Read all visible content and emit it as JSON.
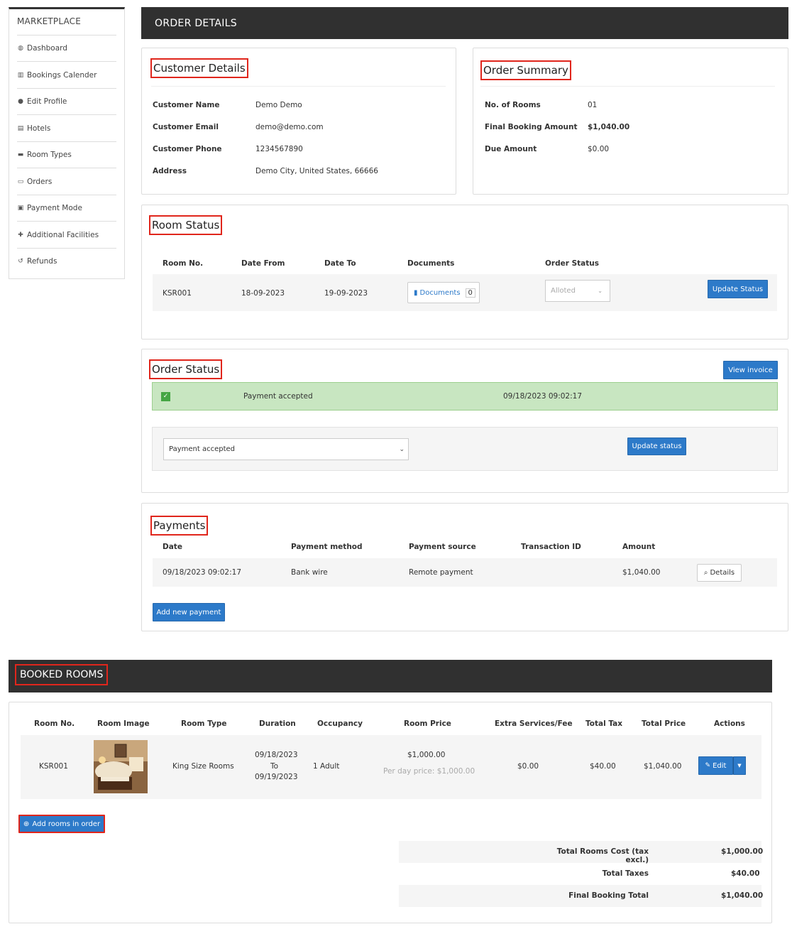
{
  "sidebar": {
    "title": "MARKETPLACE",
    "items": [
      {
        "label": "Dashboard",
        "icon": "dashboard-icon"
      },
      {
        "label": "Bookings Calender",
        "icon": "bar-chart-icon"
      },
      {
        "label": "Edit Profile",
        "icon": "user-icon"
      },
      {
        "label": "Hotels",
        "icon": "building-icon"
      },
      {
        "label": "Room Types",
        "icon": "bed-icon"
      },
      {
        "label": "Orders",
        "icon": "credit-card-icon"
      },
      {
        "label": "Payment Mode",
        "icon": "money-icon"
      },
      {
        "label": "Additional Facilities",
        "icon": "user-plus-icon"
      },
      {
        "label": "Refunds",
        "icon": "undo-icon"
      }
    ]
  },
  "header": {
    "title": "ORDER DETAILS"
  },
  "customer": {
    "title": "Customer Details",
    "name_label": "Customer Name",
    "name": "Demo  Demo",
    "email_label": "Customer Email",
    "email": "demo@demo.com",
    "phone_label": "Customer Phone",
    "phone": "1234567890",
    "address_label": "Address",
    "address": "Demo City, United States, 66666"
  },
  "summary": {
    "title": "Order Summary",
    "rooms_label": "No. of Rooms",
    "rooms": "01",
    "final_label": "Final Booking Amount",
    "final": "$1,040.00",
    "due_label": "Due Amount",
    "due": "$0.00"
  },
  "room_status": {
    "title": "Room Status",
    "headers": [
      "Room No.",
      "Date From",
      "Date To",
      "Documents",
      "Order Status"
    ],
    "row": {
      "room": "KSR001",
      "from": "18-09-2023",
      "to": "19-09-2023",
      "documents_label": "Documents",
      "documents_count": "0",
      "status": "Alloted"
    },
    "update_button": "Update Status"
  },
  "order_status": {
    "title": "Order Status",
    "view_invoice": "View invoice",
    "history_state": "Payment accepted",
    "history_date": "09/18/2023 09:02:17",
    "select_value": "Payment accepted",
    "update_button": "Update status"
  },
  "payments": {
    "title": "Payments",
    "headers": [
      "Date",
      "Payment method",
      "Payment source",
      "Transaction ID",
      "Amount"
    ],
    "row": {
      "date": "09/18/2023 09:02:17",
      "method": "Bank wire",
      "source": "Remote payment",
      "transaction": "",
      "amount": "$1,040.00"
    },
    "details_button": "Details",
    "add_button": "Add new payment"
  },
  "booked": {
    "title": "BOOKED ROOMS",
    "headers": [
      "Room No.",
      "Room Image",
      "Room Type",
      "Duration",
      "Occupancy",
      "Room Price",
      "Extra Services/Fee",
      "Total Tax",
      "Total Price",
      "Actions"
    ],
    "row": {
      "room": "KSR001",
      "type": "King Size Rooms",
      "dur_from": "09/18/2023",
      "dur_to_word": "To",
      "dur_to": "09/19/2023",
      "occupancy": "1 Adult",
      "price": "$1,000.00",
      "per_day": "Per day price: $1,000.00",
      "extra": "$0.00",
      "tax": "$40.00",
      "total": "$1,040.00",
      "edit": "Edit"
    },
    "add_rooms": "Add rooms in order",
    "totals": [
      {
        "label": "Total Rooms Cost (tax excl.)",
        "value": "$1,000.00"
      },
      {
        "label": "Total Taxes",
        "value": "$40.00"
      },
      {
        "label": "Final Booking Total",
        "value": "$1,040.00"
      }
    ]
  },
  "colors": {
    "accent": "#2d7ac9",
    "dark": "#303030",
    "highlight": "#e0261c",
    "success": "#c8e6c1"
  }
}
